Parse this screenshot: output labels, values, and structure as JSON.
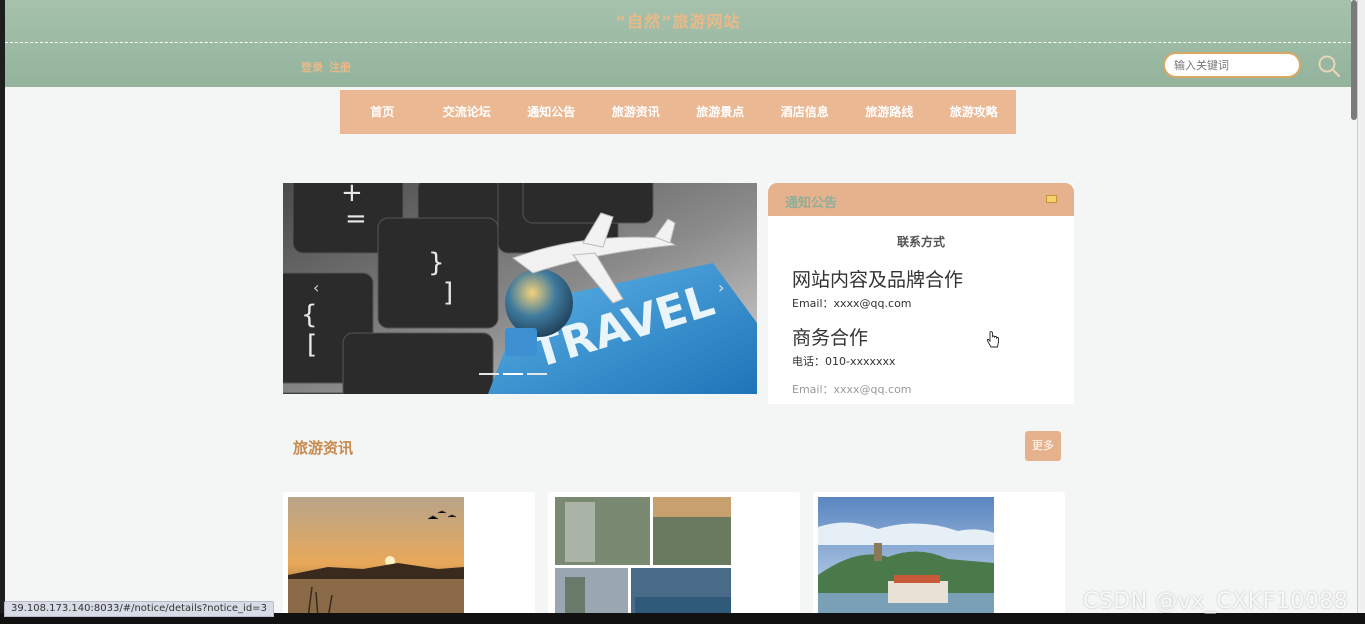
{
  "header": {
    "site_title": "“自然”旅游网站",
    "login": "登录",
    "register": "注册",
    "search_placeholder": "输入关键词"
  },
  "nav": {
    "items": [
      "首页",
      "交流论坛",
      "通知公告",
      "旅游资讯",
      "旅游景点",
      "酒店信息",
      "旅游路线",
      "旅游攻略"
    ]
  },
  "banner": {
    "text": "TRAVEL",
    "keys": [
      "+",
      "=",
      "}",
      "]",
      "{",
      "["
    ]
  },
  "notice": {
    "title": "通知公告",
    "contact_heading": "联系方式",
    "item1_title": "网站内容及品牌合作",
    "item1_email": "Email：xxxx@qq.com",
    "item2_title": "商务合作",
    "item2_phone": "电话：010-xxxxxxx",
    "item2_email": "Email：xxxx@qq.com"
  },
  "news": {
    "title": "旅游资讯",
    "more": "更多"
  },
  "status": {
    "url": "39.108.173.140:8033/#/notice/details?notice_id=3"
  },
  "watermark": "CSDN @vx_CXKF10088",
  "colors": {
    "header": "#9ebaa6",
    "accent": "#e6b28d",
    "title_text": "#e9b989"
  }
}
